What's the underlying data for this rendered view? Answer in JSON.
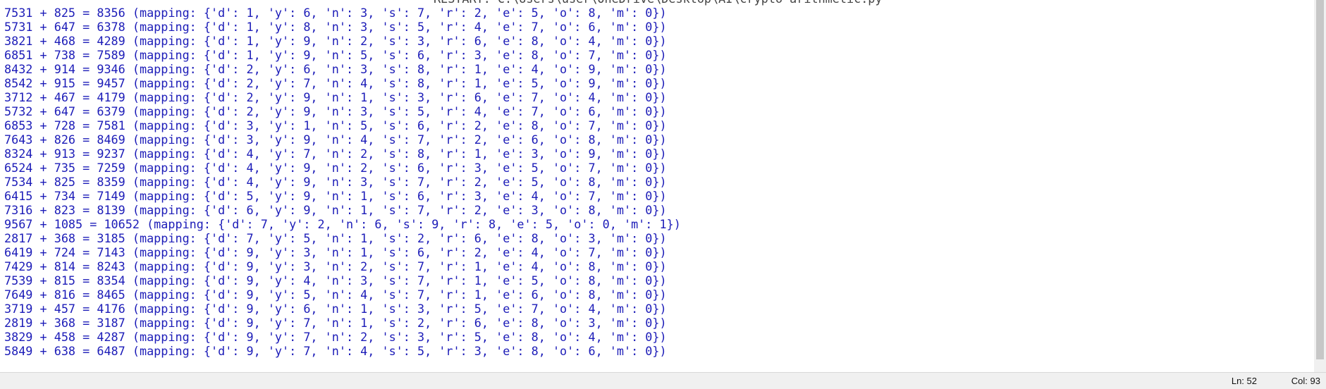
{
  "header_clipped": "RESTART: C:\\Users\\user\\OneDrive\\Desktop\\AI\\crypto-arithmetic.py",
  "lines": [
    "7531 + 825 = 8356 (mapping: {'d': 1, 'y': 6, 'n': 3, 's': 7, 'r': 2, 'e': 5, 'o': 8, 'm': 0})",
    "5731 + 647 = 6378 (mapping: {'d': 1, 'y': 8, 'n': 3, 's': 5, 'r': 4, 'e': 7, 'o': 6, 'm': 0})",
    "3821 + 468 = 4289 (mapping: {'d': 1, 'y': 9, 'n': 2, 's': 3, 'r': 6, 'e': 8, 'o': 4, 'm': 0})",
    "6851 + 738 = 7589 (mapping: {'d': 1, 'y': 9, 'n': 5, 's': 6, 'r': 3, 'e': 8, 'o': 7, 'm': 0})",
    "8432 + 914 = 9346 (mapping: {'d': 2, 'y': 6, 'n': 3, 's': 8, 'r': 1, 'e': 4, 'o': 9, 'm': 0})",
    "8542 + 915 = 9457 (mapping: {'d': 2, 'y': 7, 'n': 4, 's': 8, 'r': 1, 'e': 5, 'o': 9, 'm': 0})",
    "3712 + 467 = 4179 (mapping: {'d': 2, 'y': 9, 'n': 1, 's': 3, 'r': 6, 'e': 7, 'o': 4, 'm': 0})",
    "5732 + 647 = 6379 (mapping: {'d': 2, 'y': 9, 'n': 3, 's': 5, 'r': 4, 'e': 7, 'o': 6, 'm': 0})",
    "6853 + 728 = 7581 (mapping: {'d': 3, 'y': 1, 'n': 5, 's': 6, 'r': 2, 'e': 8, 'o': 7, 'm': 0})",
    "7643 + 826 = 8469 (mapping: {'d': 3, 'y': 9, 'n': 4, 's': 7, 'r': 2, 'e': 6, 'o': 8, 'm': 0})",
    "8324 + 913 = 9237 (mapping: {'d': 4, 'y': 7, 'n': 2, 's': 8, 'r': 1, 'e': 3, 'o': 9, 'm': 0})",
    "6524 + 735 = 7259 (mapping: {'d': 4, 'y': 9, 'n': 2, 's': 6, 'r': 3, 'e': 5, 'o': 7, 'm': 0})",
    "7534 + 825 = 8359 (mapping: {'d': 4, 'y': 9, 'n': 3, 's': 7, 'r': 2, 'e': 5, 'o': 8, 'm': 0})",
    "6415 + 734 = 7149 (mapping: {'d': 5, 'y': 9, 'n': 1, 's': 6, 'r': 3, 'e': 4, 'o': 7, 'm': 0})",
    "7316 + 823 = 8139 (mapping: {'d': 6, 'y': 9, 'n': 1, 's': 7, 'r': 2, 'e': 3, 'o': 8, 'm': 0})",
    "9567 + 1085 = 10652 (mapping: {'d': 7, 'y': 2, 'n': 6, 's': 9, 'r': 8, 'e': 5, 'o': 0, 'm': 1})",
    "2817 + 368 = 3185 (mapping: {'d': 7, 'y': 5, 'n': 1, 's': 2, 'r': 6, 'e': 8, 'o': 3, 'm': 0})",
    "6419 + 724 = 7143 (mapping: {'d': 9, 'y': 3, 'n': 1, 's': 6, 'r': 2, 'e': 4, 'o': 7, 'm': 0})",
    "7429 + 814 = 8243 (mapping: {'d': 9, 'y': 3, 'n': 2, 's': 7, 'r': 1, 'e': 4, 'o': 8, 'm': 0})",
    "7539 + 815 = 8354 (mapping: {'d': 9, 'y': 4, 'n': 3, 's': 7, 'r': 1, 'e': 5, 'o': 8, 'm': 0})",
    "7649 + 816 = 8465 (mapping: {'d': 9, 'y': 5, 'n': 4, 's': 7, 'r': 1, 'e': 6, 'o': 8, 'm': 0})",
    "3719 + 457 = 4176 (mapping: {'d': 9, 'y': 6, 'n': 1, 's': 3, 'r': 5, 'e': 7, 'o': 4, 'm': 0})",
    "2819 + 368 = 3187 (mapping: {'d': 9, 'y': 7, 'n': 1, 's': 2, 'r': 6, 'e': 8, 'o': 3, 'm': 0})",
    "3829 + 458 = 4287 (mapping: {'d': 9, 'y': 7, 'n': 2, 's': 3, 'r': 5, 'e': 8, 'o': 4, 'm': 0})",
    "5849 + 638 = 6487 (mapping: {'d': 9, 'y': 7, 'n': 4, 's': 5, 'r': 3, 'e': 8, 'o': 6, 'm': 0})"
  ],
  "status_bar": {
    "ln": "Ln: 52",
    "col": "Col: 93"
  },
  "colors": {
    "output_text": "#1c1cb8",
    "background": "#ffffff",
    "status_bg": "#f0f0f0"
  }
}
